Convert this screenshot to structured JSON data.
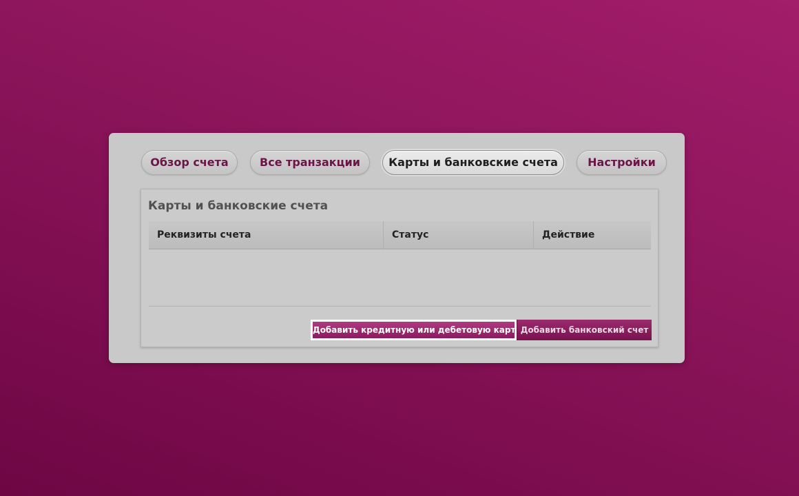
{
  "tabs": [
    {
      "label": "Обзор счета",
      "active": false
    },
    {
      "label": "Все транзакции",
      "active": false
    },
    {
      "label": "Карты и банковские счета",
      "active": true
    },
    {
      "label": "Настройки",
      "active": false
    }
  ],
  "section": {
    "title": "Карты и банковские счета"
  },
  "table": {
    "columns": [
      "Реквизиты счета",
      "Статус",
      "Действие"
    ],
    "rows": []
  },
  "actions": {
    "add_card": "Добавить кредитную или дебетовую карту",
    "add_bank_account": "Добавить банковский счет"
  },
  "colors": {
    "background": "#8a1459",
    "accent": "#8d1b5f",
    "tab_text": "#6c1448"
  }
}
